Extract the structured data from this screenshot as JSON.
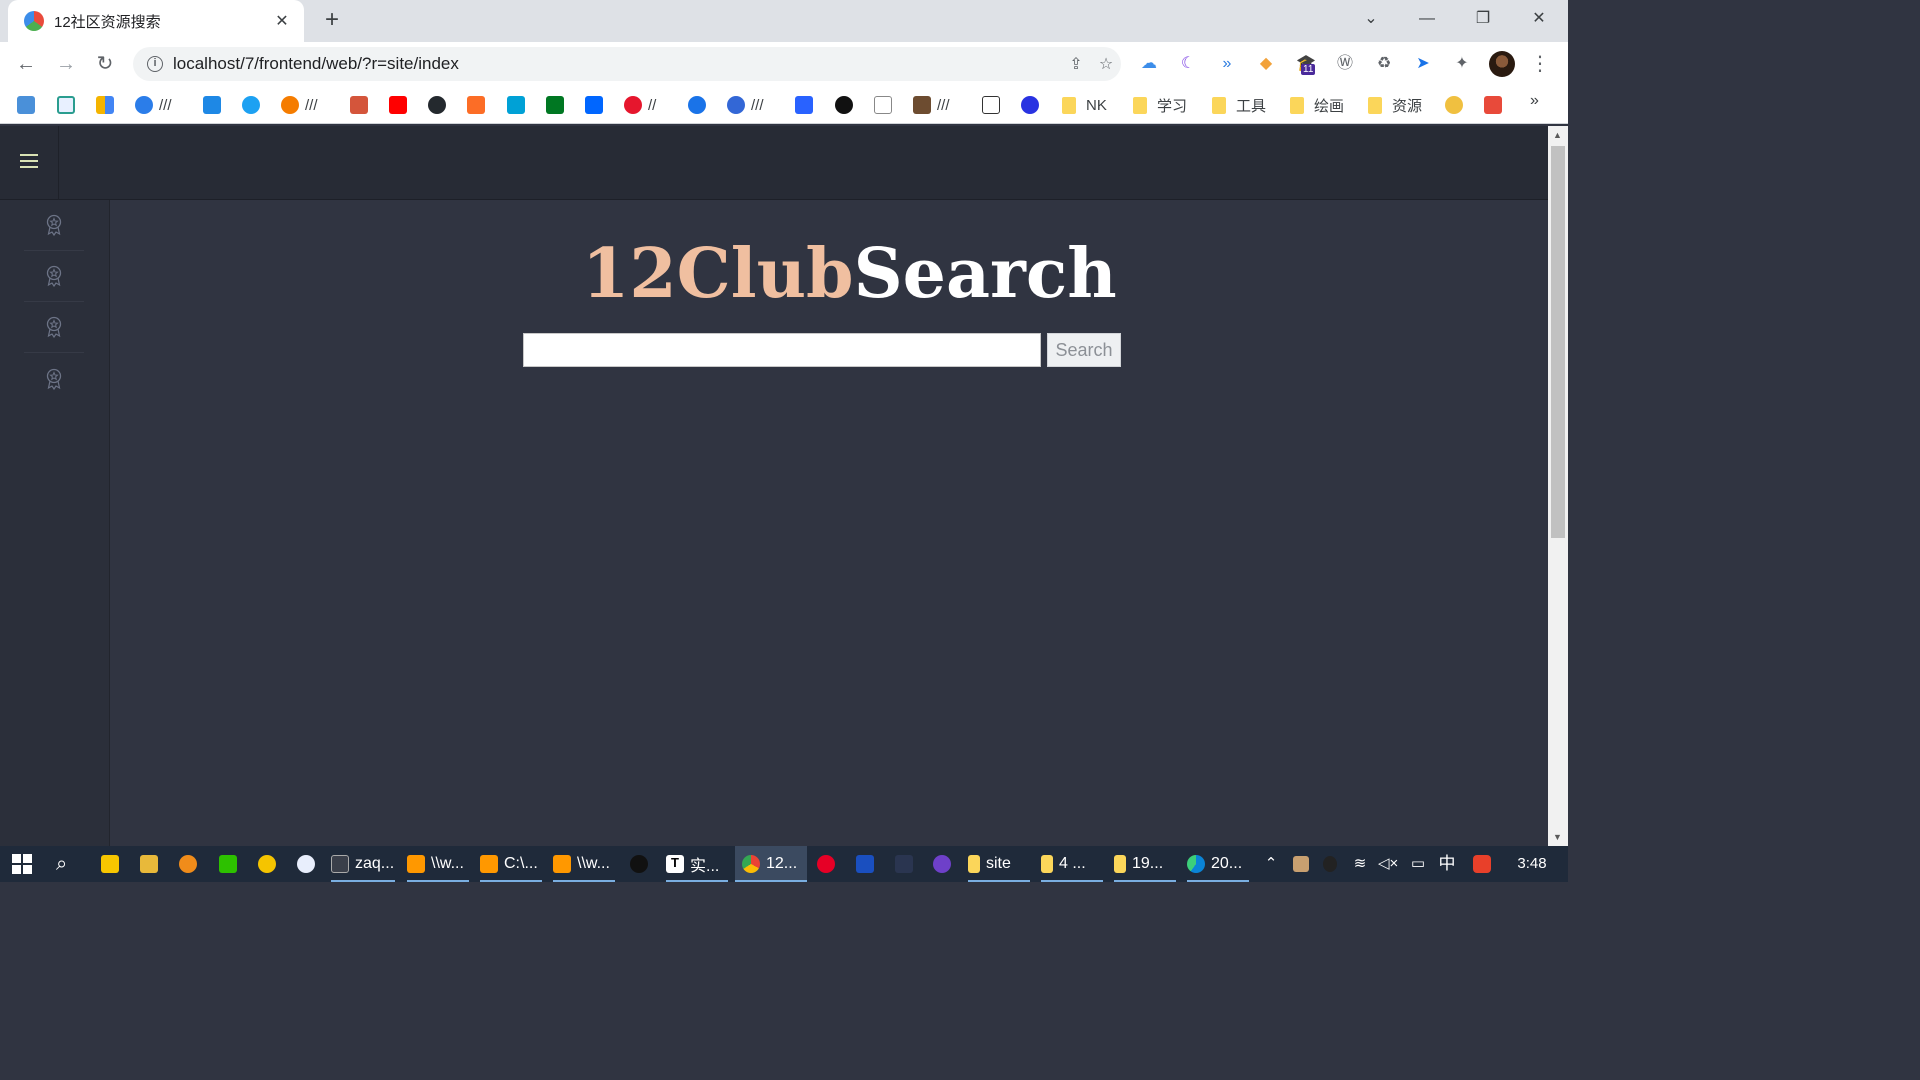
{
  "browser": {
    "tab_title": "12社区资源搜索",
    "tab_close": "✕",
    "new_tab": "+",
    "window_controls": {
      "tab_search": "⌄",
      "minimize": "—",
      "restore": "❐",
      "close": "✕"
    },
    "url": "localhost/7/frontend/web/?r=site/index",
    "nav": {
      "back": "←",
      "forward": "→",
      "reload": "↻"
    },
    "extensions_badge": "11",
    "bookmarks": [
      {
        "label": "///"
      },
      {
        "label": "///"
      },
      {
        "label": "//"
      },
      {
        "label": "///"
      },
      {
        "label": "///"
      },
      {
        "label": "NK"
      },
      {
        "label": "学习"
      },
      {
        "label": "工具"
      },
      {
        "label": "绘画"
      },
      {
        "label": "资源"
      }
    ],
    "bookmarks_more": "»"
  },
  "page": {
    "logo_part1": "12Club",
    "logo_part2": "Search",
    "search": {
      "value": "",
      "placeholder": "",
      "button_label": "Search"
    },
    "sidebar_items": 4
  },
  "taskbar": {
    "items": [
      "zaq...",
      "\\\\w...",
      "C:\\...",
      "\\\\w...",
      "实...",
      "12...",
      "site",
      "4 ...",
      "19...",
      "20..."
    ],
    "ime": "中",
    "time": "3:48"
  },
  "colors": {
    "page_bg": "#303441",
    "topnav_bg": "#272b35",
    "sidebar_bg": "#2b2f3a",
    "logo_accent": "#f0bfa0",
    "logo_main": "#ffffff",
    "hamburger": "#d9e2b4"
  }
}
